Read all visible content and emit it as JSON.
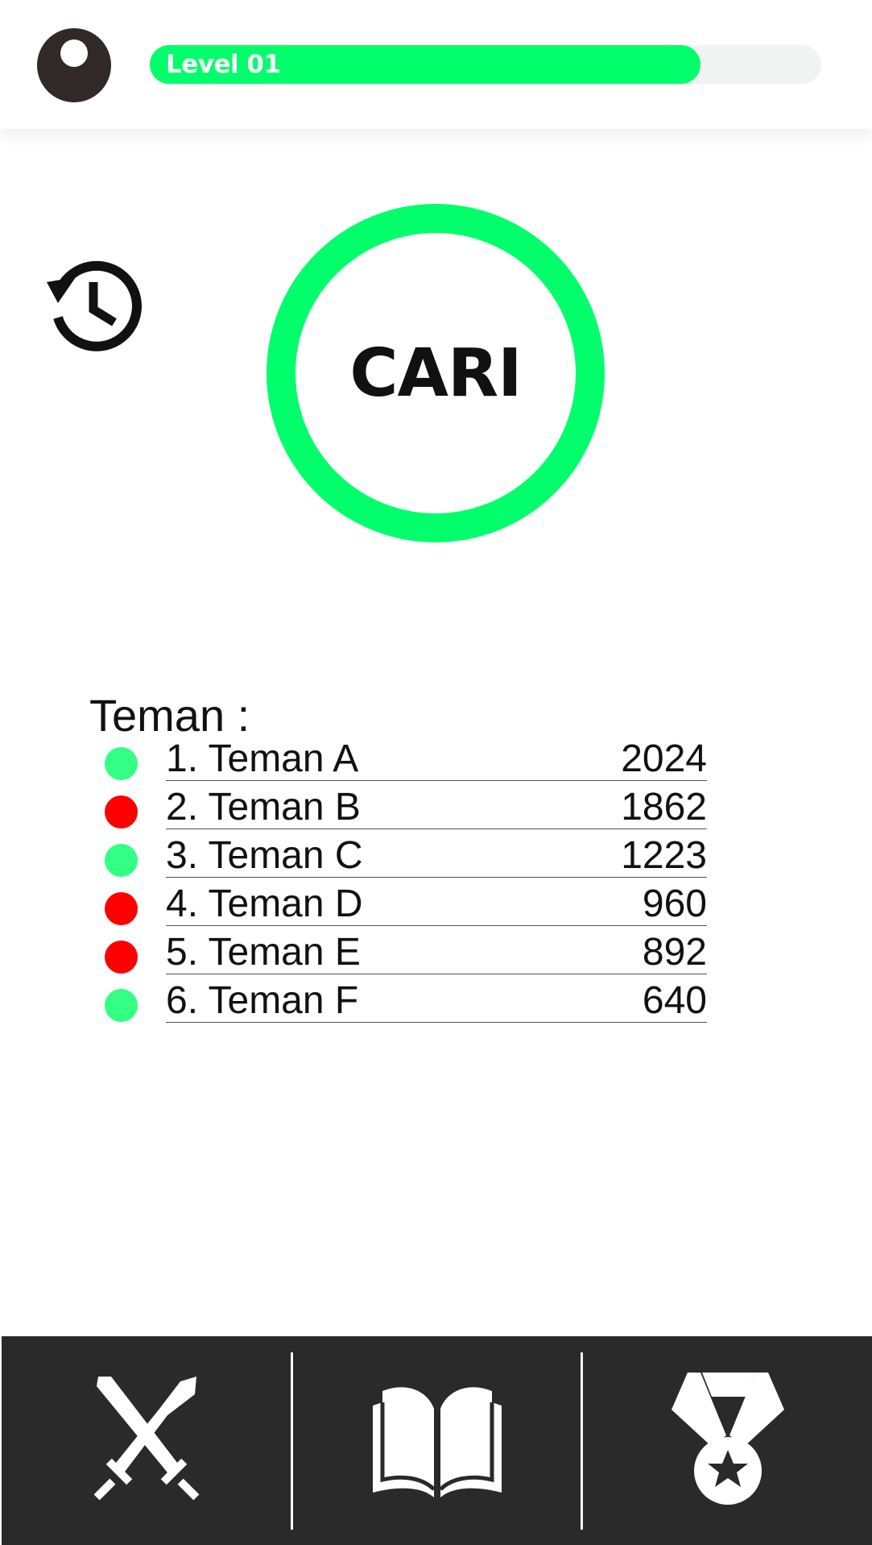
{
  "header": {
    "level_label": "Level 01",
    "level_progress": 0.82,
    "accent_color": "#00ff6a",
    "avatar_icon": "avatar-icon"
  },
  "history": {
    "icon": "history-icon"
  },
  "search": {
    "label": "CARI"
  },
  "friends": {
    "heading": "Teman :",
    "online_color": "#33ff85",
    "offline_color": "#ff0000",
    "items": [
      {
        "name": "1. Teman A",
        "score": "2024",
        "status": "online"
      },
      {
        "name": "2. Teman B",
        "score": "1862",
        "status": "offline"
      },
      {
        "name": "3. Teman C",
        "score": "1223",
        "status": "online"
      },
      {
        "name": "4. Teman D",
        "score": "960",
        "status": "offline"
      },
      {
        "name": "5. Teman E",
        "score": "892",
        "status": "offline"
      },
      {
        "name": "6. Teman F",
        "score": "640",
        "status": "online"
      }
    ]
  },
  "nav": {
    "items": [
      {
        "icon": "crossed-swords-icon"
      },
      {
        "icon": "open-book-icon"
      },
      {
        "icon": "medal-icon"
      }
    ]
  }
}
